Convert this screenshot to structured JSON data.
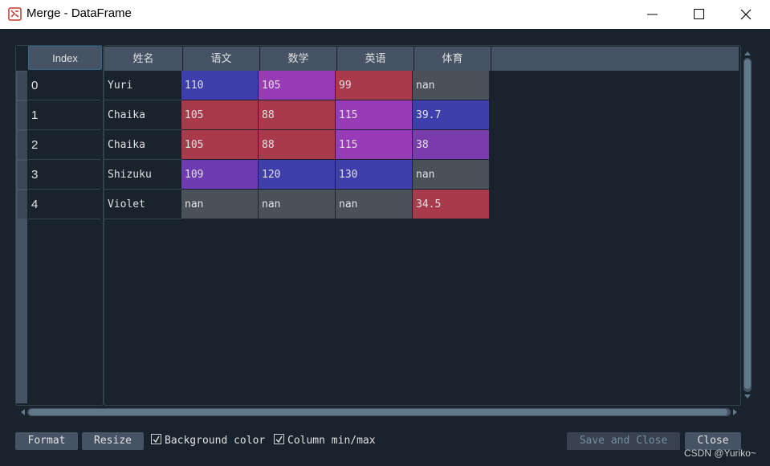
{
  "window": {
    "title": "Merge - DataFrame"
  },
  "table": {
    "index_header": "Index",
    "columns": [
      "姓名",
      "语文",
      "数学",
      "英语",
      "体育"
    ],
    "rows": [
      {
        "index": "0",
        "cells": [
          "Yuri",
          "110",
          "105",
          "99",
          "nan"
        ]
      },
      {
        "index": "1",
        "cells": [
          "Chaika",
          "105",
          "88",
          "115",
          "39.7"
        ]
      },
      {
        "index": "2",
        "cells": [
          "Chaika",
          "105",
          "88",
          "115",
          "38"
        ]
      },
      {
        "index": "3",
        "cells": [
          "Shizuku",
          "109",
          "120",
          "130",
          "nan"
        ]
      },
      {
        "index": "4",
        "cells": [
          "Violet",
          "nan",
          "nan",
          "nan",
          "34.5"
        ]
      }
    ],
    "cell_colors": [
      [
        "#19232d",
        "#3e3fad",
        "#983bb6",
        "#a93a4b",
        "#4a5159"
      ],
      [
        "#19232d",
        "#a93a4b",
        "#a93a4b",
        "#983bb6",
        "#3e3fad"
      ],
      [
        "#19232d",
        "#a93a4b",
        "#a93a4b",
        "#983bb6",
        "#7a3cad"
      ],
      [
        "#19232d",
        "#6c3cb0",
        "#3e3fad",
        "#3e3fad",
        "#4a5159"
      ],
      [
        "#19232d",
        "#4a5159",
        "#4a5159",
        "#4a5159",
        "#a93a4b"
      ]
    ]
  },
  "toolbar": {
    "format_label": "Format",
    "resize_label": "Resize",
    "bgcolor_label": "Background color",
    "bgcolor_checked": true,
    "minmax_label": "Column min/max",
    "minmax_checked": true,
    "save_close_label": "Save and Close",
    "close_label": "Close"
  },
  "watermark": "CSDN @Yuriko~",
  "colors": {
    "background": "#19232d",
    "header": "#455364",
    "accent": "#346792"
  }
}
